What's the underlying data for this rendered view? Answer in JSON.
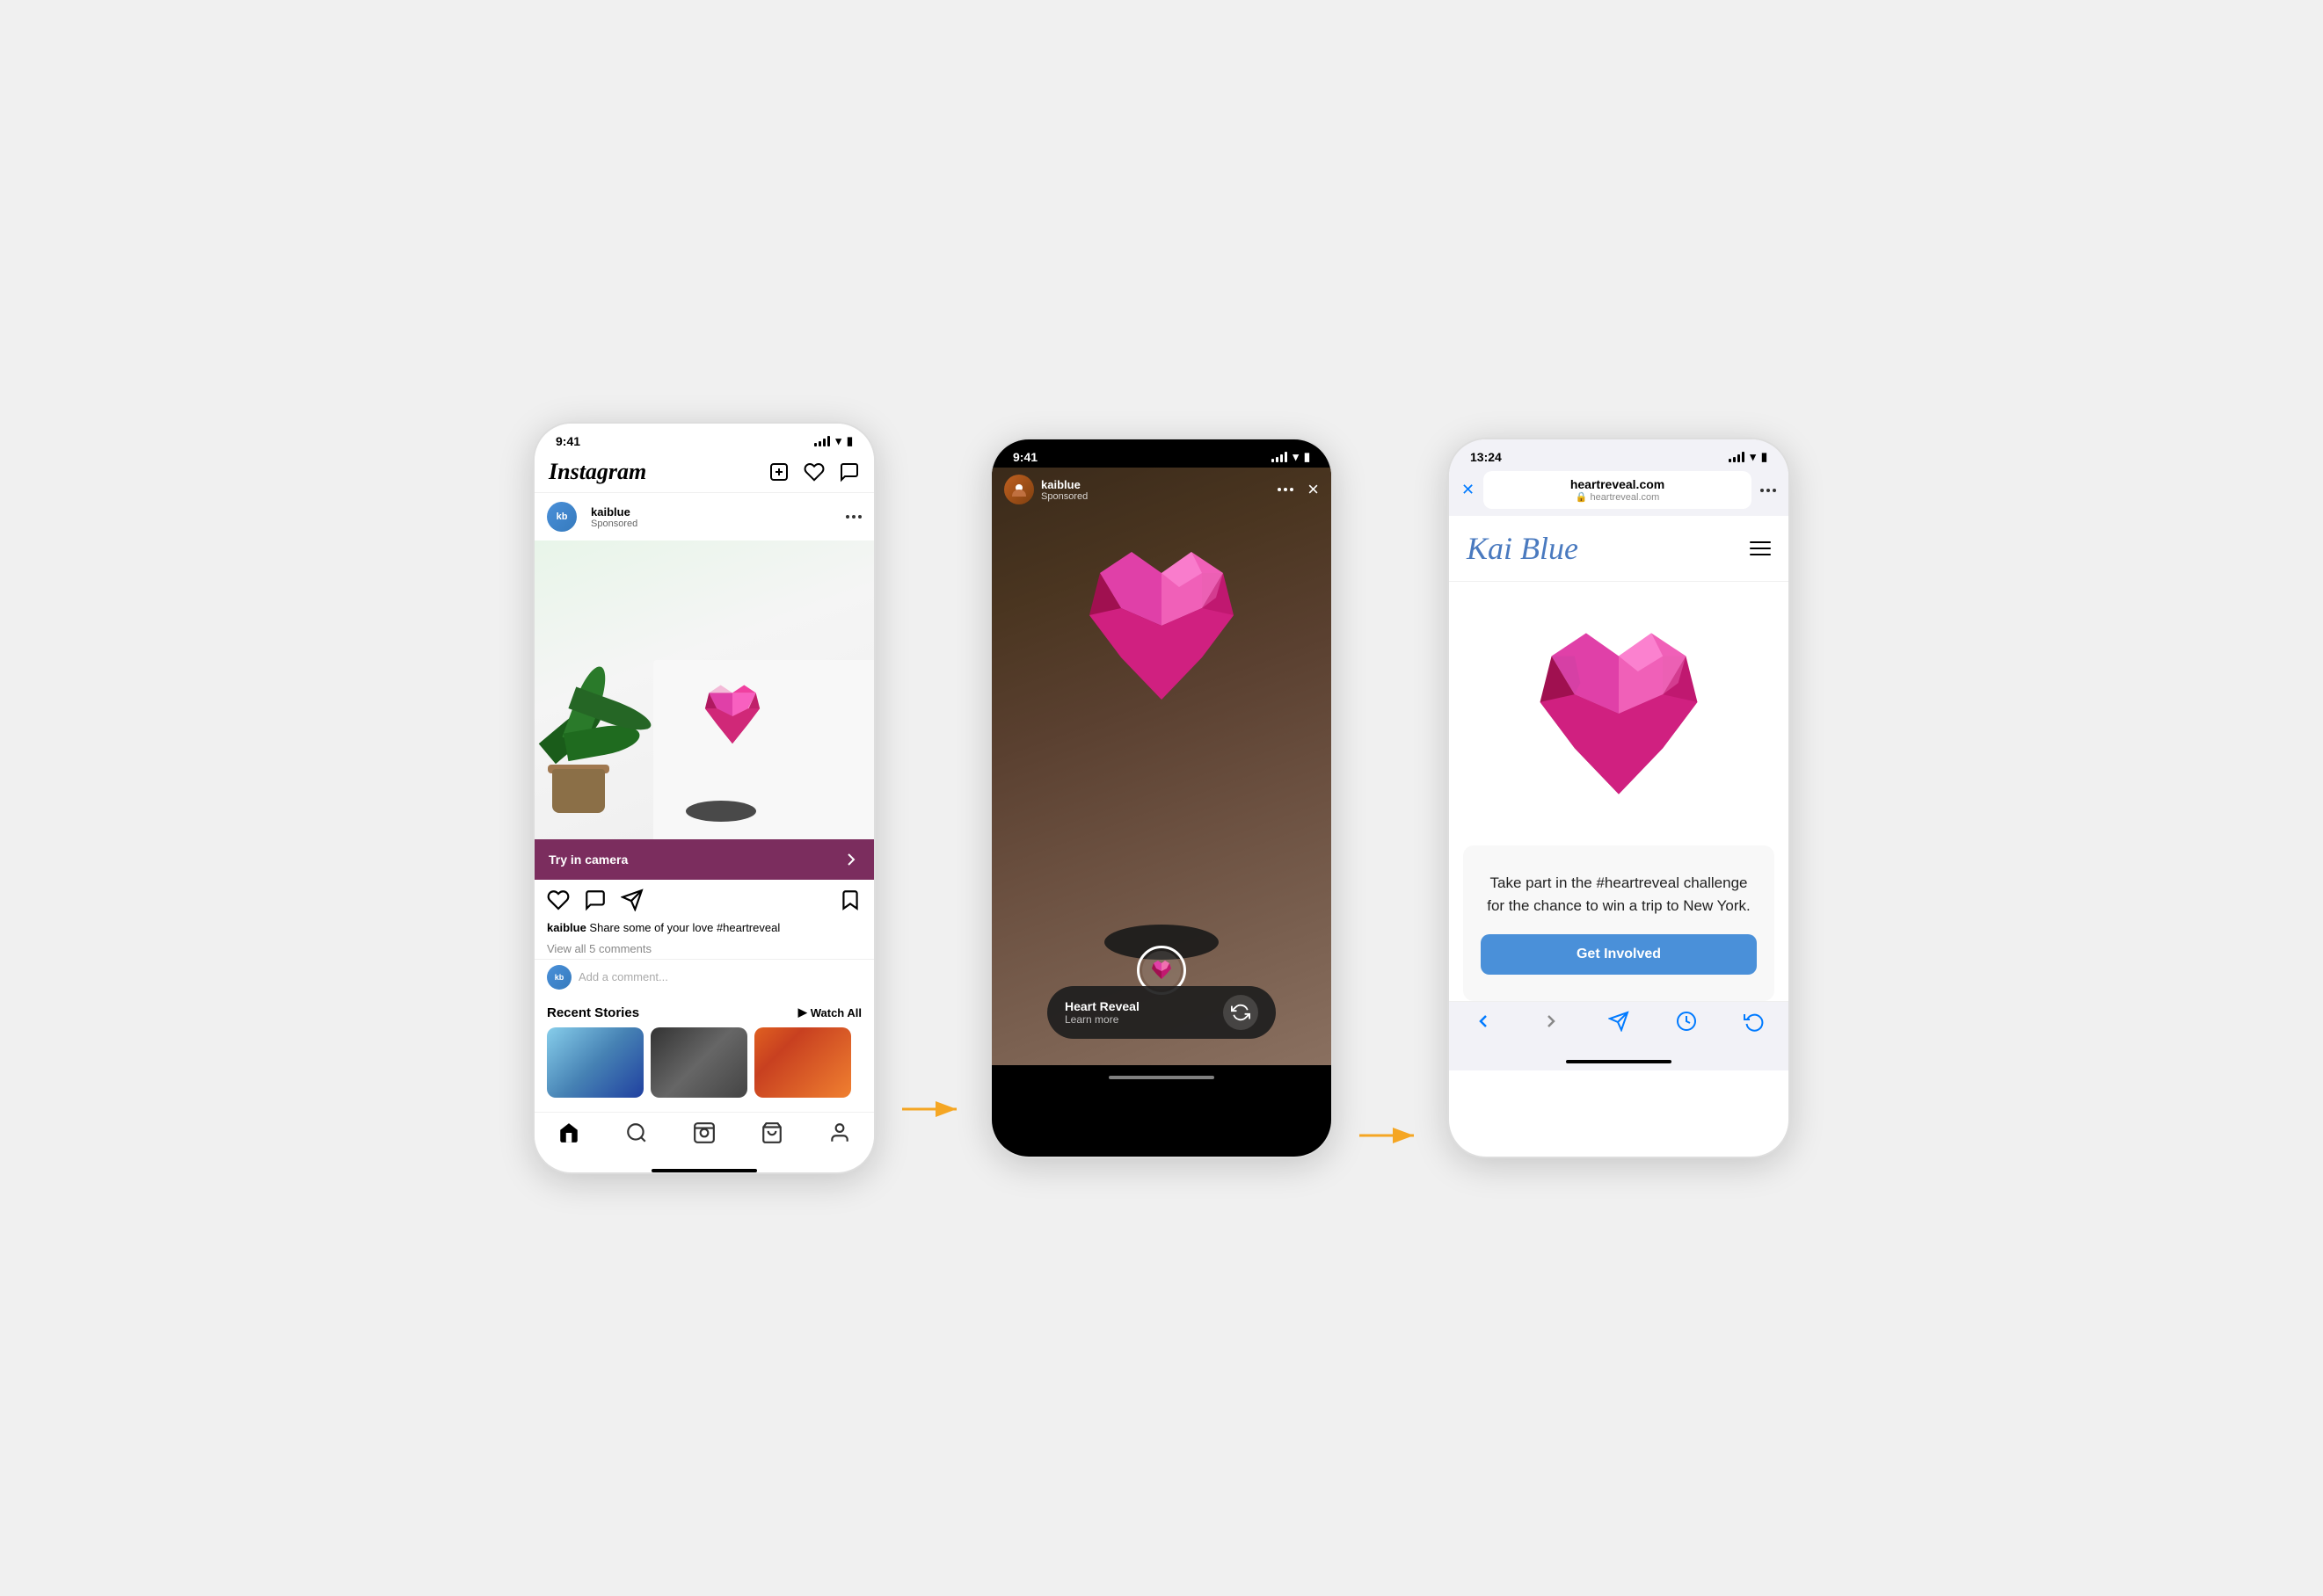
{
  "screen1": {
    "statusTime": "9:41",
    "header": {
      "logo": "Instagram",
      "icons": [
        "plus-icon",
        "heart-icon",
        "messenger-icon"
      ]
    },
    "post": {
      "username": "kaiblue",
      "sponsored": "Sponsored",
      "tryInCamera": "Try in camera",
      "actionsLeft": [
        "like-icon",
        "comment-icon",
        "share-icon"
      ],
      "bookmarkIcon": "bookmark-icon",
      "caption": "Share some of your love #heartreveal",
      "viewComments": "View all 5 comments",
      "addCommentPlaceholder": "Add a comment..."
    },
    "stories": {
      "title": "Recent Stories",
      "watchAll": "Watch All"
    },
    "bottomNav": [
      "home-icon",
      "search-icon",
      "reels-icon",
      "shop-icon",
      "profile-icon"
    ]
  },
  "screen2": {
    "statusTime": "9:41",
    "username": "kaiblue",
    "sponsored": "Sponsored",
    "filterName": "Heart Reveal",
    "filterSubLabel": "Learn more",
    "closeIcon": "×"
  },
  "screen3": {
    "statusTime": "13:24",
    "urlMain": "heartreveal.com",
    "urlSub": "heartreveal.com",
    "logoText": "Kai Blue",
    "ctaText": "Take part in the #heartreveal challenge for the chance to win a trip to New York.",
    "getInvolvedLabel": "Get Involved",
    "backIcon": "<",
    "forwardIcon": ">",
    "shareIcon": "share",
    "historyIcon": "history",
    "reloadIcon": "reload"
  },
  "arrows": {
    "color": "#f5a623"
  }
}
